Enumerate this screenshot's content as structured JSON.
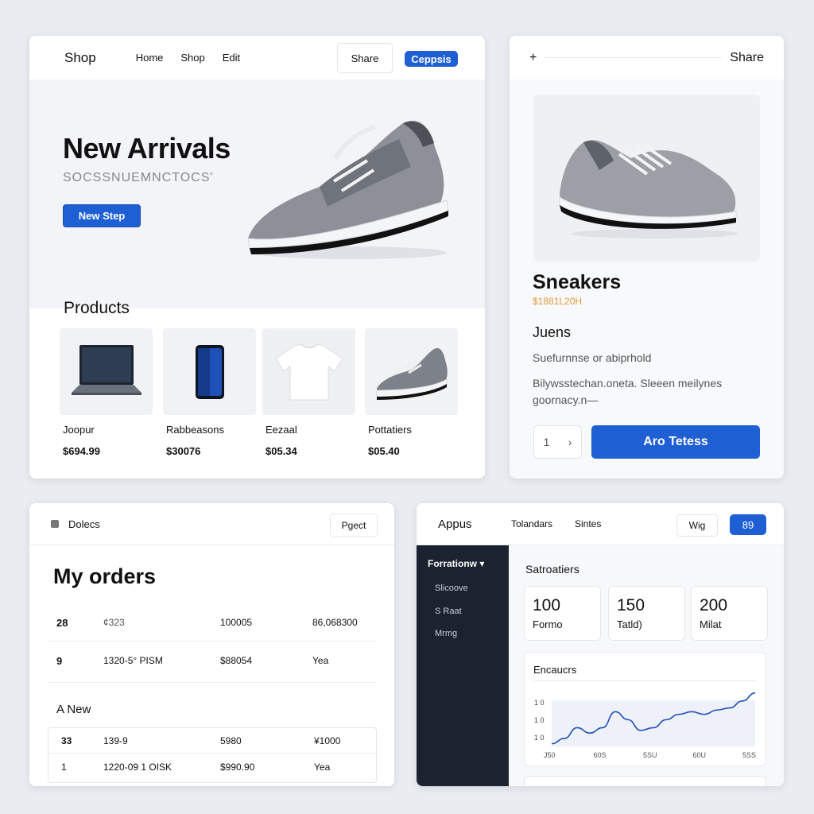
{
  "shop": {
    "brand": "Shop",
    "nav": [
      "Home",
      "Shop",
      "Edit"
    ],
    "share_label": "Share",
    "primary_label": "Ceppsis",
    "hero": {
      "title": "New Arrivals",
      "subtitle": "SOCSSNUEMNCTOCS'",
      "button": "New Step"
    },
    "products_title": "Products",
    "products": [
      {
        "name": "Joopur",
        "price": "$694.99",
        "icon": "laptop-icon"
      },
      {
        "name": "Rabbeasons",
        "price": "$30076",
        "icon": "phone-icon"
      },
      {
        "name": "Eezaal",
        "price": "$05.34",
        "icon": "tshirt-icon"
      },
      {
        "name": "Pottatiers",
        "price": "$05.40",
        "icon": "sneaker-icon"
      }
    ]
  },
  "detail": {
    "plus": "+",
    "share": "Share",
    "name": "Sneakers",
    "price": "$1881L20H",
    "subtitle": "Juens",
    "desc1": "Suefurnnse or abiprhold",
    "desc2": "Bilywsstechan.oneta. Sleeen meilynes goornacy.n—",
    "qty": "1",
    "qty_chevron": "›",
    "cta": "Aro Tetess"
  },
  "orders": {
    "header": "Dolecs",
    "header_button": "Pgect",
    "title": "My orders",
    "rows": [
      [
        "28",
        "¢323",
        "100005",
        "86,068300"
      ],
      [
        "9",
        "1320-5° PISM",
        "$88054",
        "Yea"
      ]
    ],
    "section": "A New",
    "table_rows": [
      [
        "33",
        "139-9",
        "5980",
        "¥1000"
      ],
      [
        "1",
        "1220-09 1 OISK",
        "$990.90",
        "Yea"
      ]
    ]
  },
  "dash": {
    "app": "Appus",
    "nav": [
      "Tolandars",
      "Sintes"
    ],
    "ghost_button": "Wig",
    "primary_button": "89",
    "sidebar_title": "Forrationw ▾",
    "sidebar_items": [
      "Slicoove",
      "S  Raat",
      "Mrmg"
    ],
    "section_title": "Satroatiers",
    "stats": [
      {
        "value": "100",
        "label": "Formo"
      },
      {
        "value": "150",
        "label": "Tatld)"
      },
      {
        "value": "200",
        "label": "Milat"
      }
    ],
    "colors": {
      "accent": "#1f5fd4",
      "sidebar": "#1b2330",
      "line": "#1f4fb8"
    }
  },
  "chart_data": {
    "type": "line",
    "title": "Encaucrs",
    "ytick_labels": [
      "1 0",
      "1 0",
      "1 0"
    ],
    "xtick_labels": [
      "J50",
      "60S",
      "5SU",
      "60U",
      "5SS"
    ],
    "x": [
      0,
      1,
      2,
      3,
      4,
      5,
      6,
      7,
      8,
      9,
      10,
      11,
      12,
      13,
      14,
      15,
      16
    ],
    "values": [
      0.05,
      0.15,
      0.35,
      0.25,
      0.35,
      0.65,
      0.5,
      0.3,
      0.35,
      0.5,
      0.6,
      0.65,
      0.6,
      0.68,
      0.72,
      0.85,
      1.0
    ],
    "ylim": [
      0,
      1.1
    ],
    "grid": false
  }
}
